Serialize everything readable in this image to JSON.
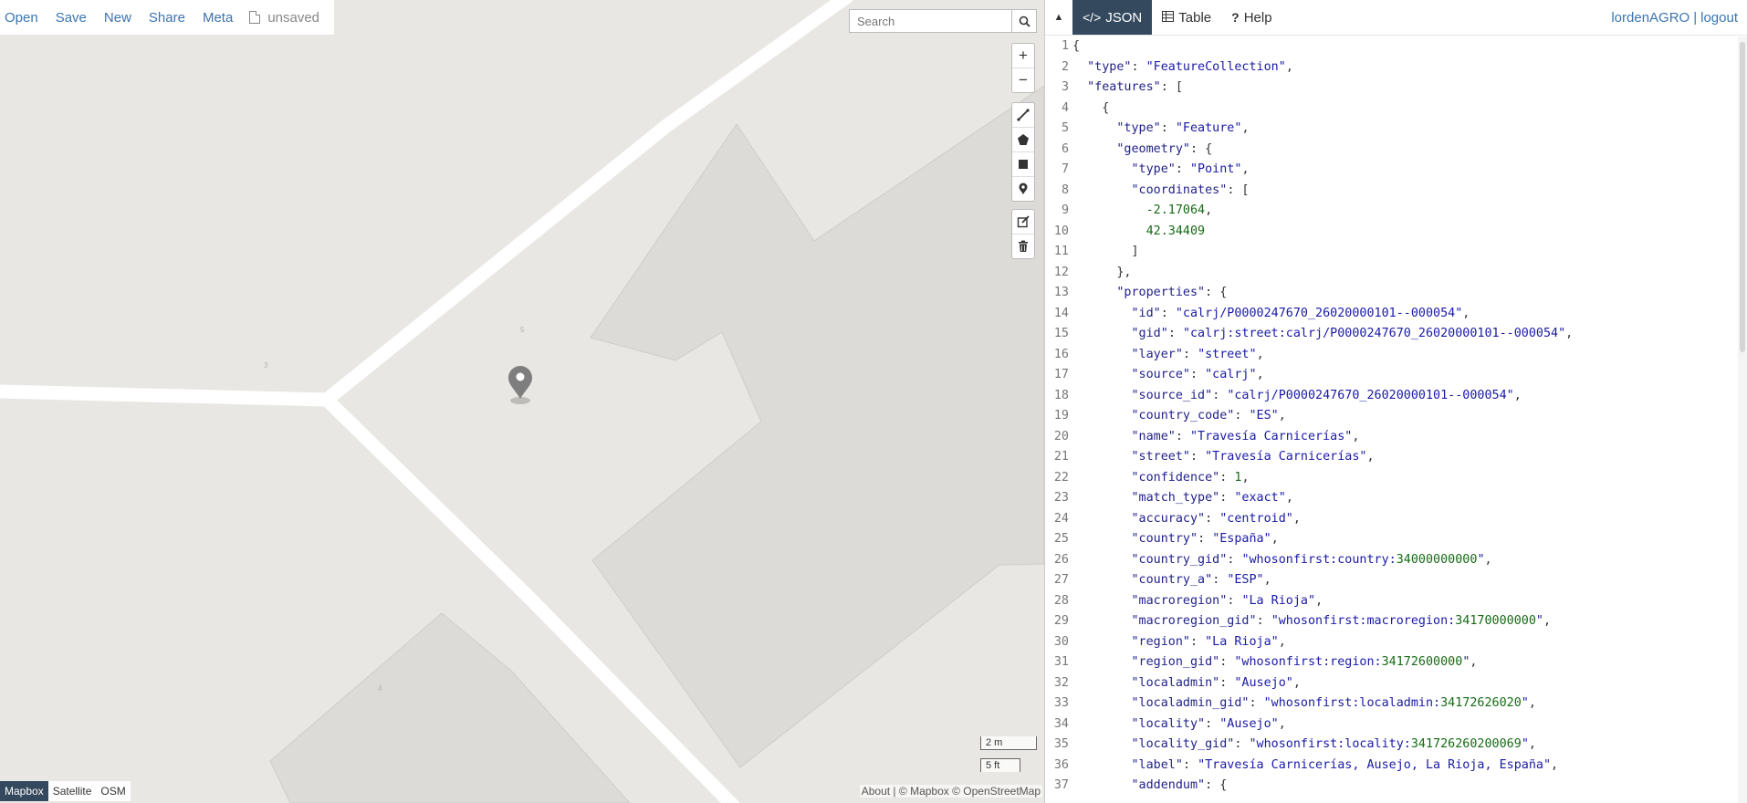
{
  "toolbar": {
    "open": "Open",
    "save": "Save",
    "new": "New",
    "share": "Share",
    "meta": "Meta",
    "file_status": "unsaved"
  },
  "search": {
    "placeholder": "Search"
  },
  "map_controls": {
    "zoom_in": "+",
    "zoom_out": "−"
  },
  "scale": {
    "metric": "2 m",
    "imperial": "5 ft"
  },
  "layers": [
    {
      "label": "Mapbox",
      "active": true
    },
    {
      "label": "Satellite",
      "active": false
    },
    {
      "label": "OSM",
      "active": false
    }
  ],
  "attribution": {
    "about": "About",
    "mapbox": "© Mapbox",
    "osm": "© OpenStreetMap"
  },
  "house_numbers": [
    "3",
    "5",
    "4"
  ],
  "panel": {
    "tabs": [
      {
        "label": "JSON",
        "icon": "code-icon",
        "active": true
      },
      {
        "label": "Table",
        "icon": "table-icon",
        "active": false
      },
      {
        "label": "Help",
        "icon": "question-icon",
        "active": false
      }
    ],
    "user": "lordenAGRO",
    "separator": "|",
    "logout": "logout"
  },
  "colors": {
    "accent": "#3c74b0",
    "active_tab": "#34495e",
    "map_bg": "#e8e7e3",
    "building": "#dddbd8",
    "road": "#ffffff",
    "marker": "#7e7e7e"
  },
  "code_lines": [
    "{",
    "  \"type\": \"FeatureCollection\",",
    "  \"features\": [",
    "    {",
    "      \"type\": \"Feature\",",
    "      \"geometry\": {",
    "        \"type\": \"Point\",",
    "        \"coordinates\": [",
    "          -2.17064,",
    "          42.34409",
    "        ]",
    "      },",
    "      \"properties\": {",
    "        \"id\": \"calrj/P0000247670_26020000101--000054\",",
    "        \"gid\": \"calrj:street:calrj/P0000247670_26020000101--000054\",",
    "        \"layer\": \"street\",",
    "        \"source\": \"calrj\",",
    "        \"source_id\": \"calrj/P0000247670_26020000101--000054\",",
    "        \"country_code\": \"ES\",",
    "        \"name\": \"Travesía Carnicerías\",",
    "        \"street\": \"Travesía Carnicerías\",",
    "        \"confidence\": 1,",
    "        \"match_type\": \"exact\",",
    "        \"accuracy\": \"centroid\",",
    "        \"country\": \"España\",",
    "        \"country_gid\": \"whosonfirst:country:34000000000\",",
    "        \"country_a\": \"ESP\",",
    "        \"macroregion\": \"La Rioja\",",
    "        \"macroregion_gid\": \"whosonfirst:macroregion:34170000000\",",
    "        \"region\": \"La Rioja\",",
    "        \"region_gid\": \"whosonfirst:region:34172600000\",",
    "        \"localadmin\": \"Ausejo\",",
    "        \"localadmin_gid\": \"whosonfirst:localadmin:34172626020\",",
    "        \"locality\": \"Ausejo\",",
    "        \"locality_gid\": \"whosonfirst:locality:341726260200069\",",
    "        \"label\": \"Travesía Carnicerías, Ausejo, La Rioja, España\",",
    "        \"addendum\": {"
  ]
}
